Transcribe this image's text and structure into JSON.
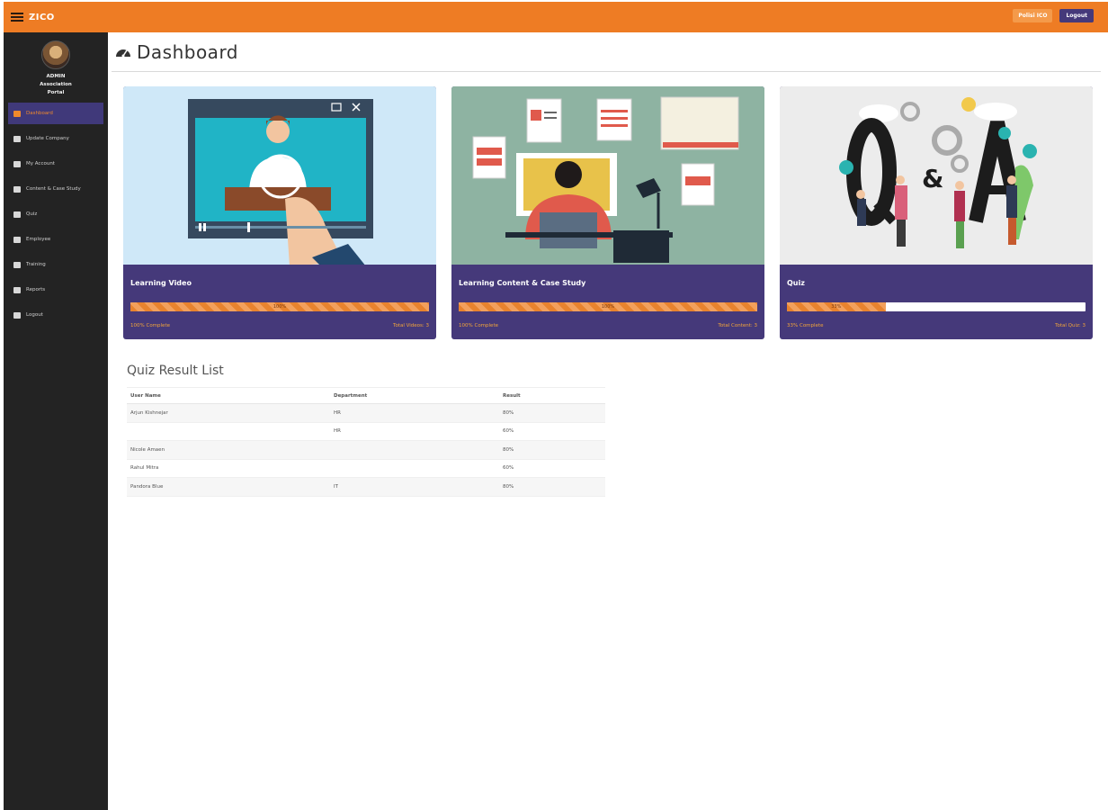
{
  "app": {
    "brand": "ZICO"
  },
  "colors": {
    "brand": "#ee7c24",
    "purple": "#45397a",
    "sidebar": "#232323",
    "accent": "#f08a2c"
  },
  "topbar": {
    "action_button": "Polisi ICO",
    "logout_label": "Logout"
  },
  "user": {
    "name": "ADMIN",
    "org": "Association",
    "role": "Portal"
  },
  "sidebar": {
    "items": [
      {
        "label": "Dashboard",
        "icon": "dashboard-icon",
        "active": true
      },
      {
        "label": "Update Company",
        "icon": "building-icon"
      },
      {
        "label": "My Account",
        "icon": "users-icon"
      },
      {
        "label": "Content & Case Study",
        "icon": "document-icon"
      },
      {
        "label": "Quiz",
        "icon": "quiz-icon"
      },
      {
        "label": "Employee",
        "icon": "employee-icon"
      },
      {
        "label": "Training",
        "icon": "book-icon"
      },
      {
        "label": "Reports",
        "icon": "home-icon"
      },
      {
        "label": "Logout",
        "icon": "user-icon"
      }
    ]
  },
  "page": {
    "title": "Dashboard"
  },
  "cards": [
    {
      "title": "Learning Video",
      "progress": 100,
      "progress_label": "100%",
      "complete_text": "100% Complete",
      "total_text": "Total Videos: 3"
    },
    {
      "title": "Learning Content & Case Study",
      "progress": 100,
      "progress_label": "100%",
      "complete_text": "100% Complete",
      "total_text": "Total Content: 3"
    },
    {
      "title": "Quiz",
      "progress": 33,
      "progress_label": "33%",
      "complete_text": "33% Complete",
      "total_text": "Total Quiz: 3"
    }
  ],
  "quiz": {
    "title": "Quiz Result List",
    "headers": [
      "User Name",
      "Department",
      "Result"
    ],
    "rows": [
      [
        "Arjun Kishnejar",
        "HR",
        "80%"
      ],
      [
        "",
        "HR",
        "60%"
      ],
      [
        "Nicole Amaen",
        "",
        "80%"
      ],
      [
        "Rahul Mitra",
        "",
        "60%"
      ],
      [
        "Pandora Blue",
        "IT",
        "80%"
      ]
    ]
  }
}
